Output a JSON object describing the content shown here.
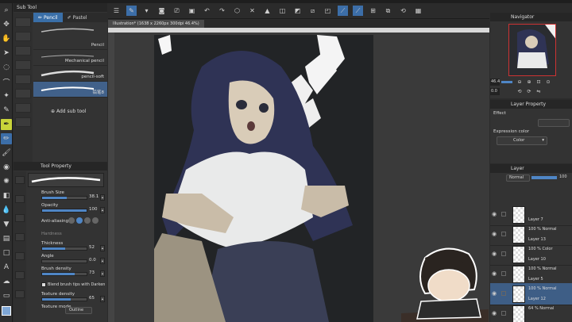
{
  "menubar": {
    "items": [
      "",
      "",
      "",
      "",
      "",
      "",
      ""
    ]
  },
  "subtool": {
    "title": "Sub Tool",
    "tabs": [
      {
        "label": "Pencil"
      },
      {
        "label": "Pastel"
      }
    ],
    "brushes": [
      {
        "name": "Pencil"
      },
      {
        "name": "Mechanical pencil"
      },
      {
        "name": "pencil-soft"
      },
      {
        "name": "铅笔8"
      }
    ],
    "add_label": "Add sub tool"
  },
  "toolprop": {
    "title": "Tool Property",
    "rows": [
      {
        "label": "Brush Size",
        "value": "38.1",
        "level": 0.55
      },
      {
        "label": "Opacity",
        "value": "100",
        "level": 1.0
      },
      {
        "label": "Anti-aliasing",
        "value": "",
        "level": 0
      },
      {
        "label": "Hardness",
        "value": "",
        "level": 0
      },
      {
        "label": "Thickness",
        "value": "52",
        "level": 0.52
      },
      {
        "label": "Angle",
        "value": "0.0",
        "level": 0.0
      },
      {
        "label": "Brush density",
        "value": "73",
        "level": 0.73
      },
      {
        "label": "Blend brush tips with Darken",
        "value": "",
        "level": 0
      },
      {
        "label": "Texture density",
        "value": "65",
        "level": 0.65
      },
      {
        "label": "Texture mode",
        "value": "Outline",
        "level": 0
      }
    ]
  },
  "document": {
    "tab_label": "Illustration* (1638 x 2260px 300dpi 46.4%)"
  },
  "navigator": {
    "title": "Navigator",
    "zoom": "46.4",
    "angle": "0.0"
  },
  "layer_property": {
    "title": "Layer Property",
    "effect_label": "Effect",
    "expression_label": "Expression color",
    "expression_value": "Color"
  },
  "layer_panel": {
    "title": "Layer",
    "blend_mode": "Normal",
    "opacity": "100",
    "layers": [
      {
        "blend": "",
        "name": "Layer 7"
      },
      {
        "blend": "100 % Normal",
        "name": "Layer 13"
      },
      {
        "blend": "100 % Color",
        "name": "Layer 10"
      },
      {
        "blend": "100 % Normal",
        "name": "Layer 5"
      },
      {
        "blend": "100 % Normal",
        "name": "Layer 12"
      },
      {
        "blend": "64 % Normal",
        "name": ""
      }
    ]
  },
  "colors": {
    "accent": "#3c6ea8",
    "hair": "#2f3355",
    "skin": "#c9bca8",
    "shirt": "#e9eaea",
    "skirt": "#3a3f56"
  }
}
